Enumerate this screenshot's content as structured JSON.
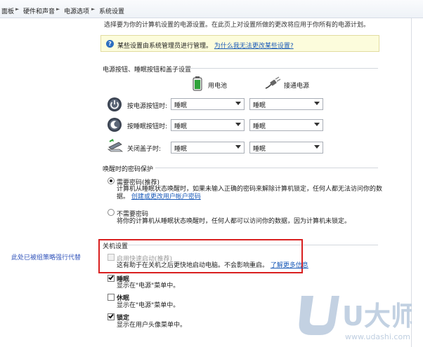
{
  "breadcrumb": [
    {
      "label": "面板"
    },
    {
      "label": "硬件和声音"
    },
    {
      "label": "电源选项"
    },
    {
      "label": "系统设置"
    }
  ],
  "truncated_description": "选择要为你的计算机设置的电源设置。在此页上对设置所做的更改将应用于你所有的电源计划。",
  "info_bar": {
    "text": "某些设置由系统管理员进行管理。",
    "link": "为什么我无法更改某些设置?"
  },
  "power_buttons": {
    "title": "电源按钮、睡眠按钮和盖子设置",
    "columns": {
      "battery": "用电池",
      "plugged_in": "接通电源"
    },
    "rows": [
      {
        "label": "按电源按钮时:",
        "battery": "睡眠",
        "plugged_in": "睡眠"
      },
      {
        "label": "按睡眠按钮时:",
        "battery": "睡眠",
        "plugged_in": "睡眠"
      },
      {
        "label": "关闭盖子时:",
        "battery": "睡眠",
        "plugged_in": "睡眠"
      }
    ]
  },
  "password": {
    "title": "唤醒时的密码保护",
    "options": [
      {
        "label": "需要密码(推荐)",
        "selected": true,
        "description": "计算机从睡眠状态唤醒时，如果未输入正确的密码来解除计算机锁定，任何人都无法访问你的数",
        "description2": "据。",
        "link": "创建或更改用户帐户密码"
      },
      {
        "label": "不需要密码",
        "selected": false,
        "description": "将你的计算机从睡眠状态唤醒时，任何人都可以访问你的数据，因为计算机未锁定。"
      }
    ]
  },
  "shutdown": {
    "title": "关机设置",
    "policy_note": "此处已被组策略强行代替",
    "fast_startup": {
      "label": "启用快速启动(推荐)",
      "description": "这有助于在关机之后更快地启动电脑。不会影响重启。",
      "link": "了解更多信息",
      "checked": false,
      "disabled": true
    },
    "options": [
      {
        "label": "睡眠",
        "checked": true,
        "description": "显示在\"电源\"菜单中。"
      },
      {
        "label": "休眠",
        "checked": false,
        "description": "显示在\"电源\"菜单中。"
      },
      {
        "label": "锁定",
        "checked": true,
        "description": "显示在用户头像菜单中。"
      }
    ]
  },
  "watermark": {
    "brand": "U大师",
    "url": "www.udashi.com"
  },
  "colors": {
    "link": "#1a5ab8",
    "highlight_border": "#d92020",
    "info_background": "#fcfcdc",
    "policy_note": "#3355bb",
    "watermark": "#b8c9dd"
  }
}
